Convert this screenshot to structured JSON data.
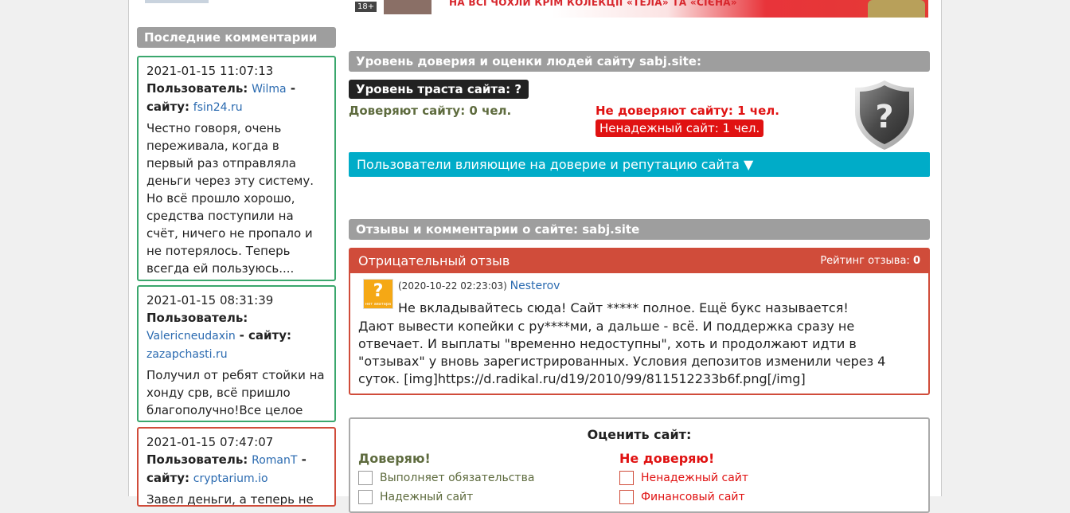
{
  "sidebar": {
    "title": "Последние комментарии",
    "comments": [
      {
        "date": "2021-01-15 11:07:13",
        "user_label": "Пользователь:",
        "user": "Wilma",
        "site_label": " - сайту:",
        "site": "fsin24.ru",
        "text": "Честно говоря, очень переживала, когда в первый раз отправляла деньги через эту систему. Но всё прошло хорошо, средства поступили на счёт, ничего не пропало и не потерялось. Теперь всегда ей пользуюсь....",
        "sentiment": "positive"
      },
      {
        "date": "2021-01-15 08:31:39",
        "user_label": "Пользователь:",
        "user": "Valericneudaxin",
        "site_label": " - сайту:",
        "site": "zazapchasti.ru",
        "text": "Получил от ребят стойки на хонду срв, всё пришло благополучно!Все целое только ставь и езжай...",
        "sentiment": "positive"
      },
      {
        "date": "2021-01-15 07:47:07",
        "user_label": "Пользователь:",
        "user": "RomanT",
        "site_label": " - сайту:",
        "site": "cryptarium.io",
        "text": "Завел деньги, а теперь не",
        "sentiment": "negative"
      }
    ]
  },
  "banner": {
    "age_tag": "18+",
    "text": "НА ВСІ ЧОХЛИ КРІМ КОЛЕКЦІЇ «ТЕЛА» ТА «СІЄНА»"
  },
  "trust": {
    "title": "Уровень доверия и оценки людей сайту sabj.site:",
    "level": "Уровень траста сайта: ?",
    "trust_count": "Доверяют сайту: 0 чел.",
    "distrust_count": "Не доверяют сайту: 1 чел.",
    "unreliable": "Ненадежный сайт: 1 чел.",
    "users_toggle": "Пользователи влияющие на доверие и репутацию сайта ▼",
    "shield_symbol": "?"
  },
  "reviews": {
    "title": "Отзывы и комментарии о сайте: sabj.site",
    "items": [
      {
        "type": "Отрицательный отзыв",
        "rating_label": "Рейтинг отзыва:",
        "rating": "0",
        "date": "(2020-10-22 02:23:03)",
        "author": "Nesterov",
        "avatar_symbol": "?",
        "avatar_caption": "нет аватара",
        "line1": "Не вкладывайтесь сюда! Сайт ***** полное. Ещё букс называется!",
        "body": "Дают вывести копейки с ру****ми, а дальше - всё. И поддержка сразу не отвечает. И выплаты \"временно недоступны\", хоть и продолжают идти в \"отзывах\" у вновь зарегистрированных. Условия депозитов изменили через 4 суток. [img]https://d.radikal.ru/d19/2010/99/811512233b6f.png[/img]"
      }
    ]
  },
  "rate": {
    "title": "Оценить сайт:",
    "trust_head": "Доверяю!",
    "distrust_head": "Не доверяю!",
    "trust_options": [
      "Выполняет обязательства",
      "Надежный сайт"
    ],
    "distrust_options": [
      "Ненадежный сайт",
      "Финансовый сайт"
    ]
  },
  "colors": {
    "positive_border": "#3aa76d",
    "negative_border": "#d04c3a",
    "section_bar": "#9e9e9e",
    "users_bar": "#00acc8",
    "distrust_red": "#e01212",
    "trust_olive": "#5e6b3e"
  }
}
